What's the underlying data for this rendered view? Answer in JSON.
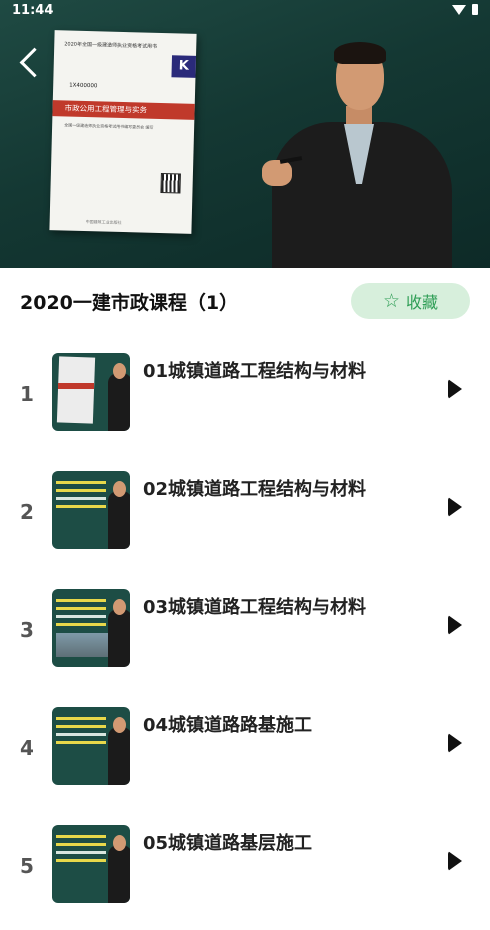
{
  "status_bar": {
    "time": "11:44"
  },
  "video": {
    "book_cover": {
      "header": "2020年全国一级建造师执业资格考试用书",
      "badge": "K",
      "code": "1X400000",
      "title": "市政公用工程管理与实务",
      "subtitle": "全国一级建造师执业资格考试用书编写委员会 编写",
      "publisher": "中国建筑工业出版社"
    }
  },
  "course": {
    "title": "2020一建市政课程（1）",
    "favorite_label": "收藏"
  },
  "lessons": [
    {
      "index": "1",
      "title": "01城镇道路工程结构与材料",
      "thumb": "book"
    },
    {
      "index": "2",
      "title": "02城镇道路工程结构与材料",
      "thumb": "text"
    },
    {
      "index": "3",
      "title": "03城镇道路工程结构与材料",
      "thumb": "road"
    },
    {
      "index": "4",
      "title": "04城镇道路路基施工",
      "thumb": "text"
    },
    {
      "index": "5",
      "title": "05城镇道路基层施工",
      "thumb": "text"
    }
  ],
  "colors": {
    "accent_green": "#2f9e56",
    "favorite_bg": "#d7efdc",
    "video_bg": "#143833"
  }
}
